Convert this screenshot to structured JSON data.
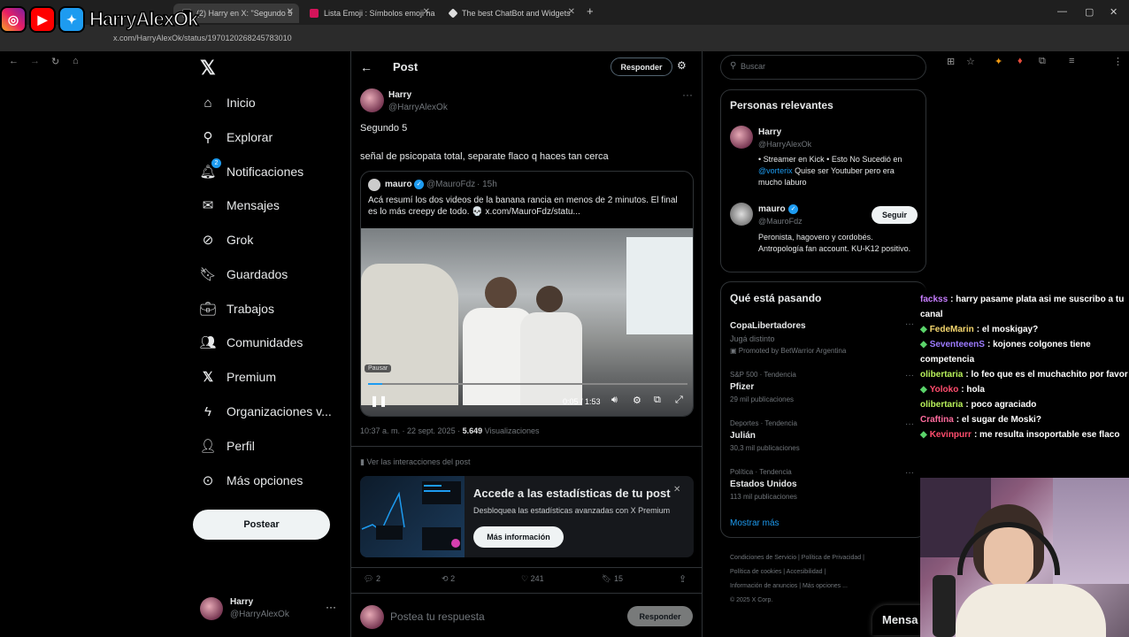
{
  "browser": {
    "tabs": [
      {
        "label": "(2) Harry en X: \"Segundo 5",
        "active": true
      },
      {
        "label": "Lista Emoji : Símbolos emoji na",
        "active": false
      },
      {
        "label": "The best ChatBot and Widgets",
        "active": false
      }
    ],
    "url": "x.com/HarryAlexOk/status/1970120268245783010",
    "new_tab": "+"
  },
  "brand": {
    "name": "HarryAlexOk"
  },
  "sidebar": {
    "items": [
      {
        "label": "Inicio",
        "icon": "home-icon"
      },
      {
        "label": "Explorar",
        "icon": "search-icon"
      },
      {
        "label": "Notificaciones",
        "icon": "bell-icon",
        "badge": "2"
      },
      {
        "label": "Mensajes",
        "icon": "mail-icon"
      },
      {
        "label": "Grok",
        "icon": "grok-icon"
      },
      {
        "label": "Guardados",
        "icon": "bookmark-icon"
      },
      {
        "label": "Trabajos",
        "icon": "briefcase-icon"
      },
      {
        "label": "Comunidades",
        "icon": "people-icon"
      },
      {
        "label": "Premium",
        "icon": "x-logo-icon"
      },
      {
        "label": "Organizaciones v...",
        "icon": "lightning-icon"
      },
      {
        "label": "Perfil",
        "icon": "person-icon"
      },
      {
        "label": "Más opciones",
        "icon": "more-circle-icon"
      }
    ],
    "post_button": "Postear",
    "account": {
      "name": "Harry",
      "handle": "@HarryAlexOk",
      "more": "···"
    }
  },
  "header": {
    "title": "Post",
    "reply_button": "Responder"
  },
  "post": {
    "author": "Harry",
    "handle": "@HarryAlexOk",
    "text1": "Segundo 5",
    "text2": "señal de psicopata total, separate flaco q haces tan cerca",
    "quote": {
      "author": "mauro",
      "handle": "@MauroFdz",
      "time": "· 15h",
      "text": "Acá resumí los dos videos de la banana rancia en menos de 2 minutos. El final es lo más creepy de todo. 💀 x.com/MauroFdz/statu..."
    },
    "video": {
      "tooltip": "Pausar",
      "time": "0:05 / 1:53",
      "progress": 0.044
    },
    "timestamp": "10:37 a. m. · 22 sept. 2025 ·",
    "views": "5.649",
    "views_label": "Visualizaciones",
    "interactions_link": "Ver las interacciones del post",
    "promo": {
      "title": "Accede a las estadísticas de tu post",
      "subtitle": "Desbloquea las estadísticas avanzadas con X Premium",
      "button": "Más información"
    },
    "actions": {
      "replies": "2",
      "reposts": "2",
      "likes": "241",
      "bookmarks": "15"
    },
    "reply_placeholder": "Postea tu respuesta",
    "reply_button": "Responder"
  },
  "right": {
    "search_placeholder": "Buscar",
    "relevant": {
      "title": "Personas relevantes",
      "people": [
        {
          "name": "Harry",
          "handle": "@HarryAlexOk",
          "bio_pre": "• Streamer en Kick • Esto No Sucedió en ",
          "bio_link": "@vorterix",
          "bio_post": " Quise ser Youtuber pero era mucho laburo"
        },
        {
          "name": "mauro",
          "handle": "@MauroFdz",
          "bio": "Peronista, hagovero y cordobés. Antropología fan account. KU-K12 positivo.",
          "follow": "Seguir"
        }
      ]
    },
    "trends": {
      "title": "Qué está pasando",
      "items": [
        {
          "name": "CopaLibertadores",
          "sub": "Jugá distinto",
          "promo": "Promoted by BetWarrior Argentina"
        },
        {
          "cat": "S&P 500 · Tendencia",
          "name": "Pfizer",
          "cnt": "29 mil publicaciones"
        },
        {
          "cat": "Deportes · Tendencia",
          "name": "Julián",
          "cnt": "30,3 mil publicaciones"
        },
        {
          "cat": "Política · Tendencia",
          "name": "Estados Unidos",
          "cnt": "113 mil publicaciones"
        }
      ],
      "more": "Mostrar más"
    },
    "footer": {
      "l1": "Condiciones de Servicio  |  Política de Privacidad  |",
      "l2": "Política de cookies  |  Accesibilidad  |",
      "l3": "Información de anuncios  |  Más opciones ...",
      "l4": "© 2025 X Corp."
    },
    "messages_tab": "Mensa"
  },
  "chat": [
    {
      "user": "fackss",
      "text": ": harry pasame plata asi me suscribo a tu canal",
      "color": "#c77dff",
      "gem": false
    },
    {
      "user": "FedeMarin",
      "text": ": el moskigay?",
      "color": "#f5d76e",
      "gem": true
    },
    {
      "user": "SeventeeenS",
      "text": ": kojones colgones tiene competencia",
      "color": "#9d7bff",
      "gem": true
    },
    {
      "user": "olibertaria",
      "text": ": lo feo que es el muchachito por favor",
      "color": "#b8f15a",
      "gem": false
    },
    {
      "user": "Yoloko",
      "text": ": hola",
      "color": "#ff4d6d",
      "gem": true
    },
    {
      "user": "olibertaria",
      "text": ": poco agraciado",
      "color": "#b8f15a",
      "gem": false
    },
    {
      "user": "Craftina",
      "text": ": el sugar de Moski?",
      "color": "#ff6b9d",
      "gem": false
    },
    {
      "user": "Kevinpurr",
      "text": ": me resulta insoportable ese flaco",
      "color": "#ff4d6d",
      "gem": true
    }
  ]
}
